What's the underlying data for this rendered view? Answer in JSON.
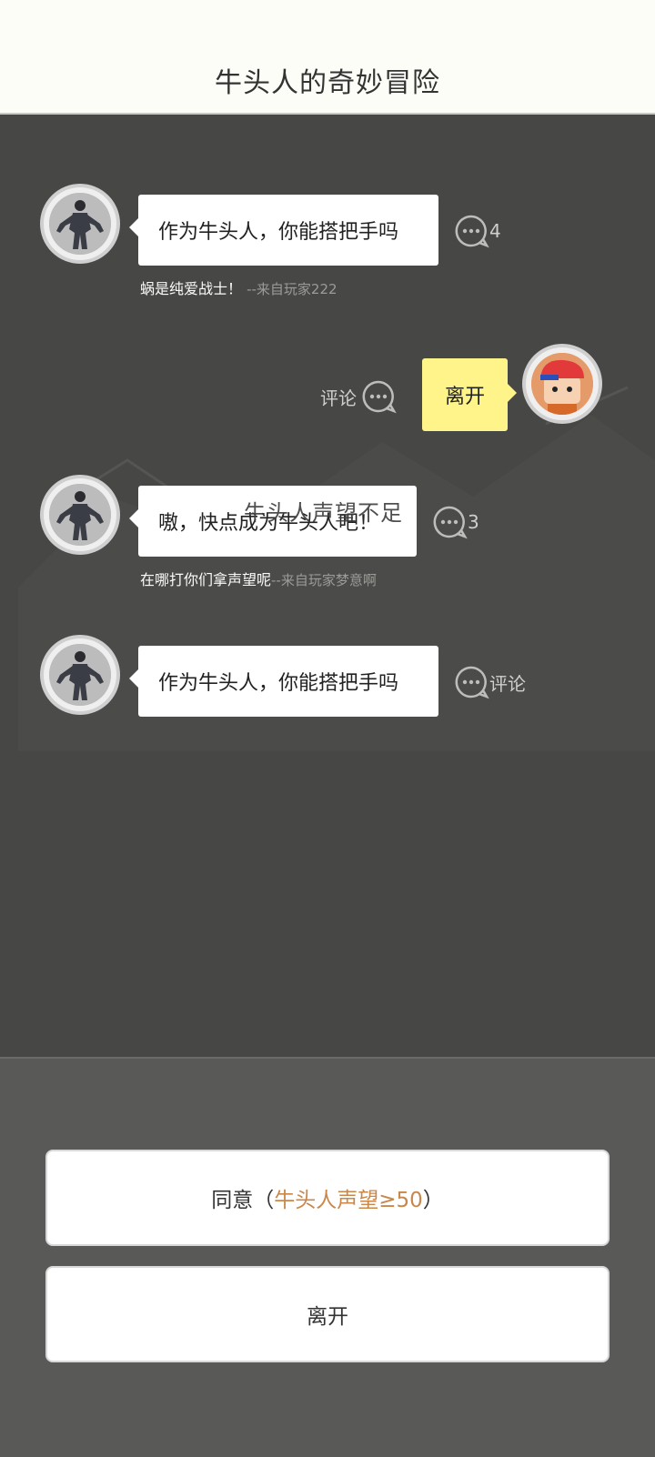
{
  "header": {
    "title": "牛头人的奇妙冒险"
  },
  "messages": [
    {
      "text": "作为牛头人，你能搭把手吗",
      "comment_count": "4",
      "attribution": "蜗是纯爱战士！",
      "attribution_from": "--来自玩家222"
    },
    {
      "text": "离开",
      "comment_label": "评论"
    },
    {
      "text": "嗷，快点成为牛头人吧！",
      "overlay": "牛头人声望不足",
      "comment_count": "3",
      "attribution": "在哪打你们拿声望呢",
      "attribution_from": "--来自玩家梦意啊"
    },
    {
      "text": "作为牛头人，你能搭把手吗",
      "comment_label": "评论"
    }
  ],
  "actions": {
    "agree_label": "同意（",
    "agree_requirement": "牛头人声望≥50",
    "agree_close": "）",
    "leave_label": "离开"
  },
  "icons": {
    "comment": "comment-bubble-icon",
    "npc": "armored-figure-icon",
    "player": "red-cap-player-icon"
  },
  "colors": {
    "bubble_player": "#fff48a",
    "requirement": "#c9874a"
  }
}
